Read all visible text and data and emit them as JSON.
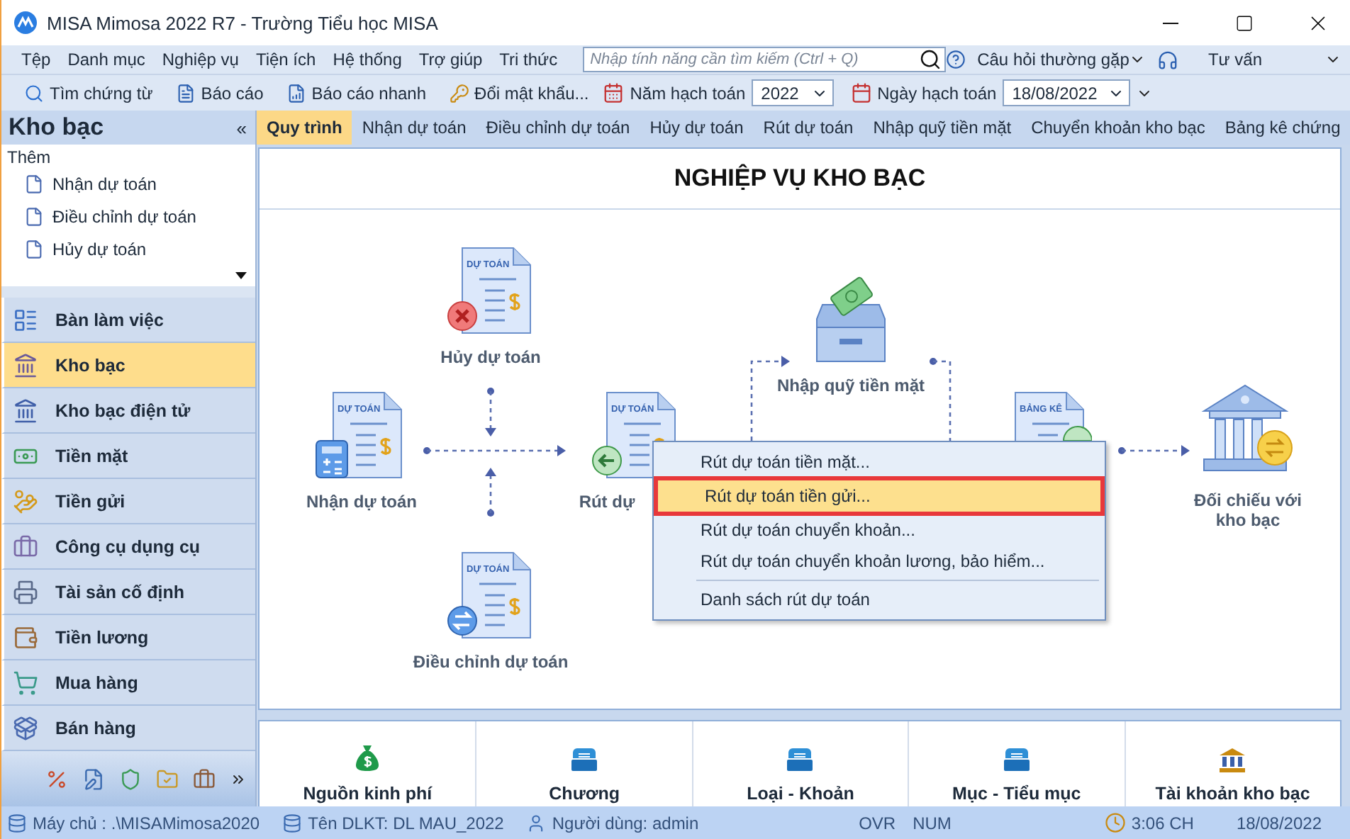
{
  "window": {
    "title": "MISA Mimosa 2022 R7 - Trường Tiểu học MISA"
  },
  "menu_bar": {
    "items": [
      "Tệp",
      "Danh mục",
      "Nghiệp vụ",
      "Tiện ích",
      "Hệ thống",
      "Trợ giúp",
      "Tri thức"
    ],
    "search": {
      "placeholder": "Nhập tính năng cần tìm kiếm (Ctrl + Q)"
    },
    "faq": "Câu hỏi thường gặp",
    "advice": "Tư vấn"
  },
  "toolbar": {
    "buttons": [
      "Tìm chứng từ",
      "Báo cáo",
      "Báo cáo nhanh",
      "Đổi mật khẩu..."
    ],
    "year_label": "Năm hạch toán",
    "year": "2022",
    "date_label": "Ngày hạch toán",
    "date": "18/08/2022"
  },
  "sidebar": {
    "title": "Kho bạc",
    "collapse": "«",
    "section": "Thêm",
    "quick_items": [
      "Nhận dự toán",
      "Điều chỉnh dự toán",
      "Hủy dự toán"
    ],
    "items": [
      {
        "label": "Bàn làm việc",
        "selected": false
      },
      {
        "label": "Kho bạc",
        "selected": true
      },
      {
        "label": "Kho bạc điện tử",
        "selected": false
      },
      {
        "label": "Tiền mặt",
        "selected": false
      },
      {
        "label": "Tiền gửi",
        "selected": false
      },
      {
        "label": "Công cụ dụng cụ",
        "selected": false
      },
      {
        "label": "Tài sản cố định",
        "selected": false
      },
      {
        "label": "Tiền lương",
        "selected": false
      },
      {
        "label": "Mua hàng",
        "selected": false
      },
      {
        "label": "Bán hàng",
        "selected": false
      }
    ]
  },
  "tabs": [
    {
      "label": "Quy trình",
      "selected": true
    },
    {
      "label": "Nhận dự toán",
      "selected": false
    },
    {
      "label": "Điều chỉnh dự toán",
      "selected": false
    },
    {
      "label": "Hủy dự toán",
      "selected": false
    },
    {
      "label": "Rút dự toán",
      "selected": false
    },
    {
      "label": "Nhập quỹ tiền mặt",
      "selected": false
    },
    {
      "label": "Chuyển khoản kho bạc",
      "selected": false
    },
    {
      "label": "Bảng kê chứng",
      "selected": false
    }
  ],
  "diagram": {
    "title": "NGHIỆP VỤ KHO BẠC",
    "nodes": [
      {
        "kind": "cancel-doc",
        "doc_label": "DỰ TOÁN",
        "label": "Hủy dự toán"
      },
      {
        "kind": "budget-doc",
        "doc_label": "DỰ TOÁN",
        "label": "Nhận dự toán"
      },
      {
        "kind": "withdraw-doc",
        "doc_label": "DỰ TOÁN",
        "label": "Rút dự"
      },
      {
        "kind": "cash-drawer",
        "label": "Nhập quỹ tiền mặt"
      },
      {
        "kind": "statement-doc",
        "doc_label": "BẢNG KÊ"
      },
      {
        "kind": "bank",
        "label": "Đối chiếu với kho bạc"
      },
      {
        "kind": "adjust-doc",
        "doc_label": "DỰ TOÁN",
        "label": "Điều chỉnh dự toán"
      }
    ]
  },
  "context_menu": {
    "items": [
      {
        "label": "Rút dự toán tiền mặt...",
        "selected": false
      },
      {
        "label": "Rút dự toán tiền gửi...",
        "selected": true
      },
      {
        "label": "Rút dự toán chuyển khoản...",
        "selected": false
      },
      {
        "label": "Rút dự toán chuyển khoản lương, bảo hiểm...",
        "selected": false
      },
      {
        "label": "Danh sách rút dự toán",
        "selected": false
      }
    ]
  },
  "categories": [
    {
      "kind": "money-bag",
      "label": "Nguồn kinh phí"
    },
    {
      "kind": "tray",
      "label": "Chương"
    },
    {
      "kind": "tray",
      "label": "Loại - Khoản"
    },
    {
      "kind": "tray",
      "label": "Mục - Tiểu mục"
    },
    {
      "kind": "bank",
      "label": "Tài khoản kho bạc"
    }
  ],
  "status_bar": {
    "server": "Máy chủ : .\\MISAMimosa2020",
    "database": "Tên DLKT: DL MAU_2022",
    "user": "Người dùng: admin",
    "ovr": "OVR",
    "num": "NUM",
    "time": "3:06 CH",
    "date": "18/08/2022"
  }
}
